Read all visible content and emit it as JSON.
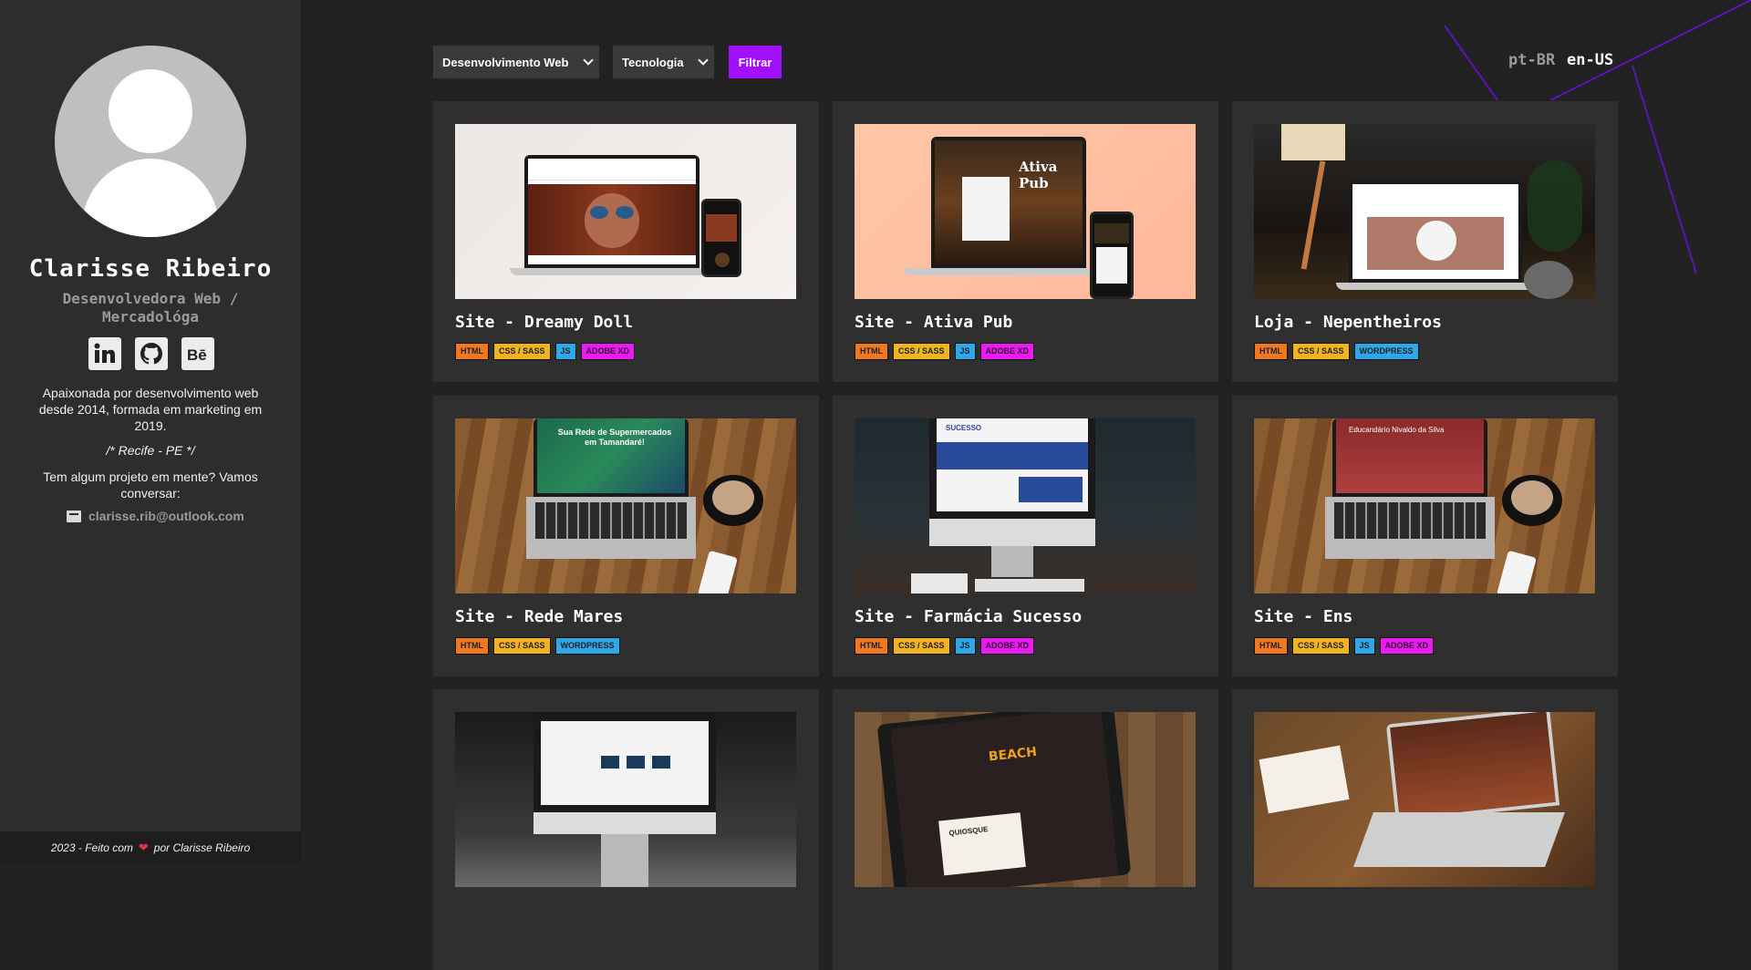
{
  "profile": {
    "name": "Clarisse Ribeiro",
    "role": "Desenvolvedora Web / Mercadológa",
    "bio": "Apaixonada por desenvolvimento web desde 2014, formada em marketing em 2019.",
    "location": "/* Recife - PE */",
    "cta": "Tem algum projeto em mente? Vamos conversar:",
    "email": "clarisse.rib@outlook.com",
    "socials": [
      {
        "name": "linkedin-icon",
        "label": "in"
      },
      {
        "name": "github-icon",
        "label": "github"
      },
      {
        "name": "behance-icon",
        "label": "Bē"
      }
    ]
  },
  "footer": {
    "prefix": "2023 - Feito com",
    "heart": "❤",
    "suffix": "por Clarisse Ribeiro"
  },
  "filters": {
    "category": "Desenvolvimento Web",
    "tech": "Tecnologia",
    "button": "Filtrar"
  },
  "languages": {
    "pt": "pt-BR",
    "en": "en-US"
  },
  "colors": {
    "accent": "#a010ff",
    "html": "#f07820",
    "css": "#f0b423",
    "js": "#2ea8e8",
    "xd": "#e81cf0"
  },
  "projects": [
    {
      "title": "Site - Dreamy Doll",
      "tags": [
        "HTML",
        "CSS / SASS",
        "JS",
        "ADOBE XD"
      ]
    },
    {
      "title": "Site - Ativa Pub",
      "tags": [
        "HTML",
        "CSS / SASS",
        "JS",
        "ADOBE XD"
      ]
    },
    {
      "title": "Loja - Nepentheiros",
      "tags": [
        "HTML",
        "CSS / SASS",
        "WORDPRESS"
      ]
    },
    {
      "title": "Site - Rede Mares",
      "tags": [
        "HTML",
        "CSS / SASS",
        "WORDPRESS"
      ]
    },
    {
      "title": "Site - Farmácia Sucesso",
      "tags": [
        "HTML",
        "CSS / SASS",
        "JS",
        "ADOBE XD"
      ]
    },
    {
      "title": "Site - Ens",
      "tags": [
        "HTML",
        "CSS / SASS",
        "JS",
        "ADOBE XD"
      ]
    },
    {
      "title": "",
      "tags": []
    },
    {
      "title": "",
      "tags": []
    },
    {
      "title": "",
      "tags": []
    }
  ],
  "thumb_texts": {
    "ativa": "Ativa Pub",
    "mares": "Sua Rede de Supermercados em Tamandaré!",
    "sucesso": "SUCESSO",
    "ens": "Educandário Nivaldo da Silva",
    "beach": "BEACH",
    "quiosque": "QUIOSQUE"
  }
}
